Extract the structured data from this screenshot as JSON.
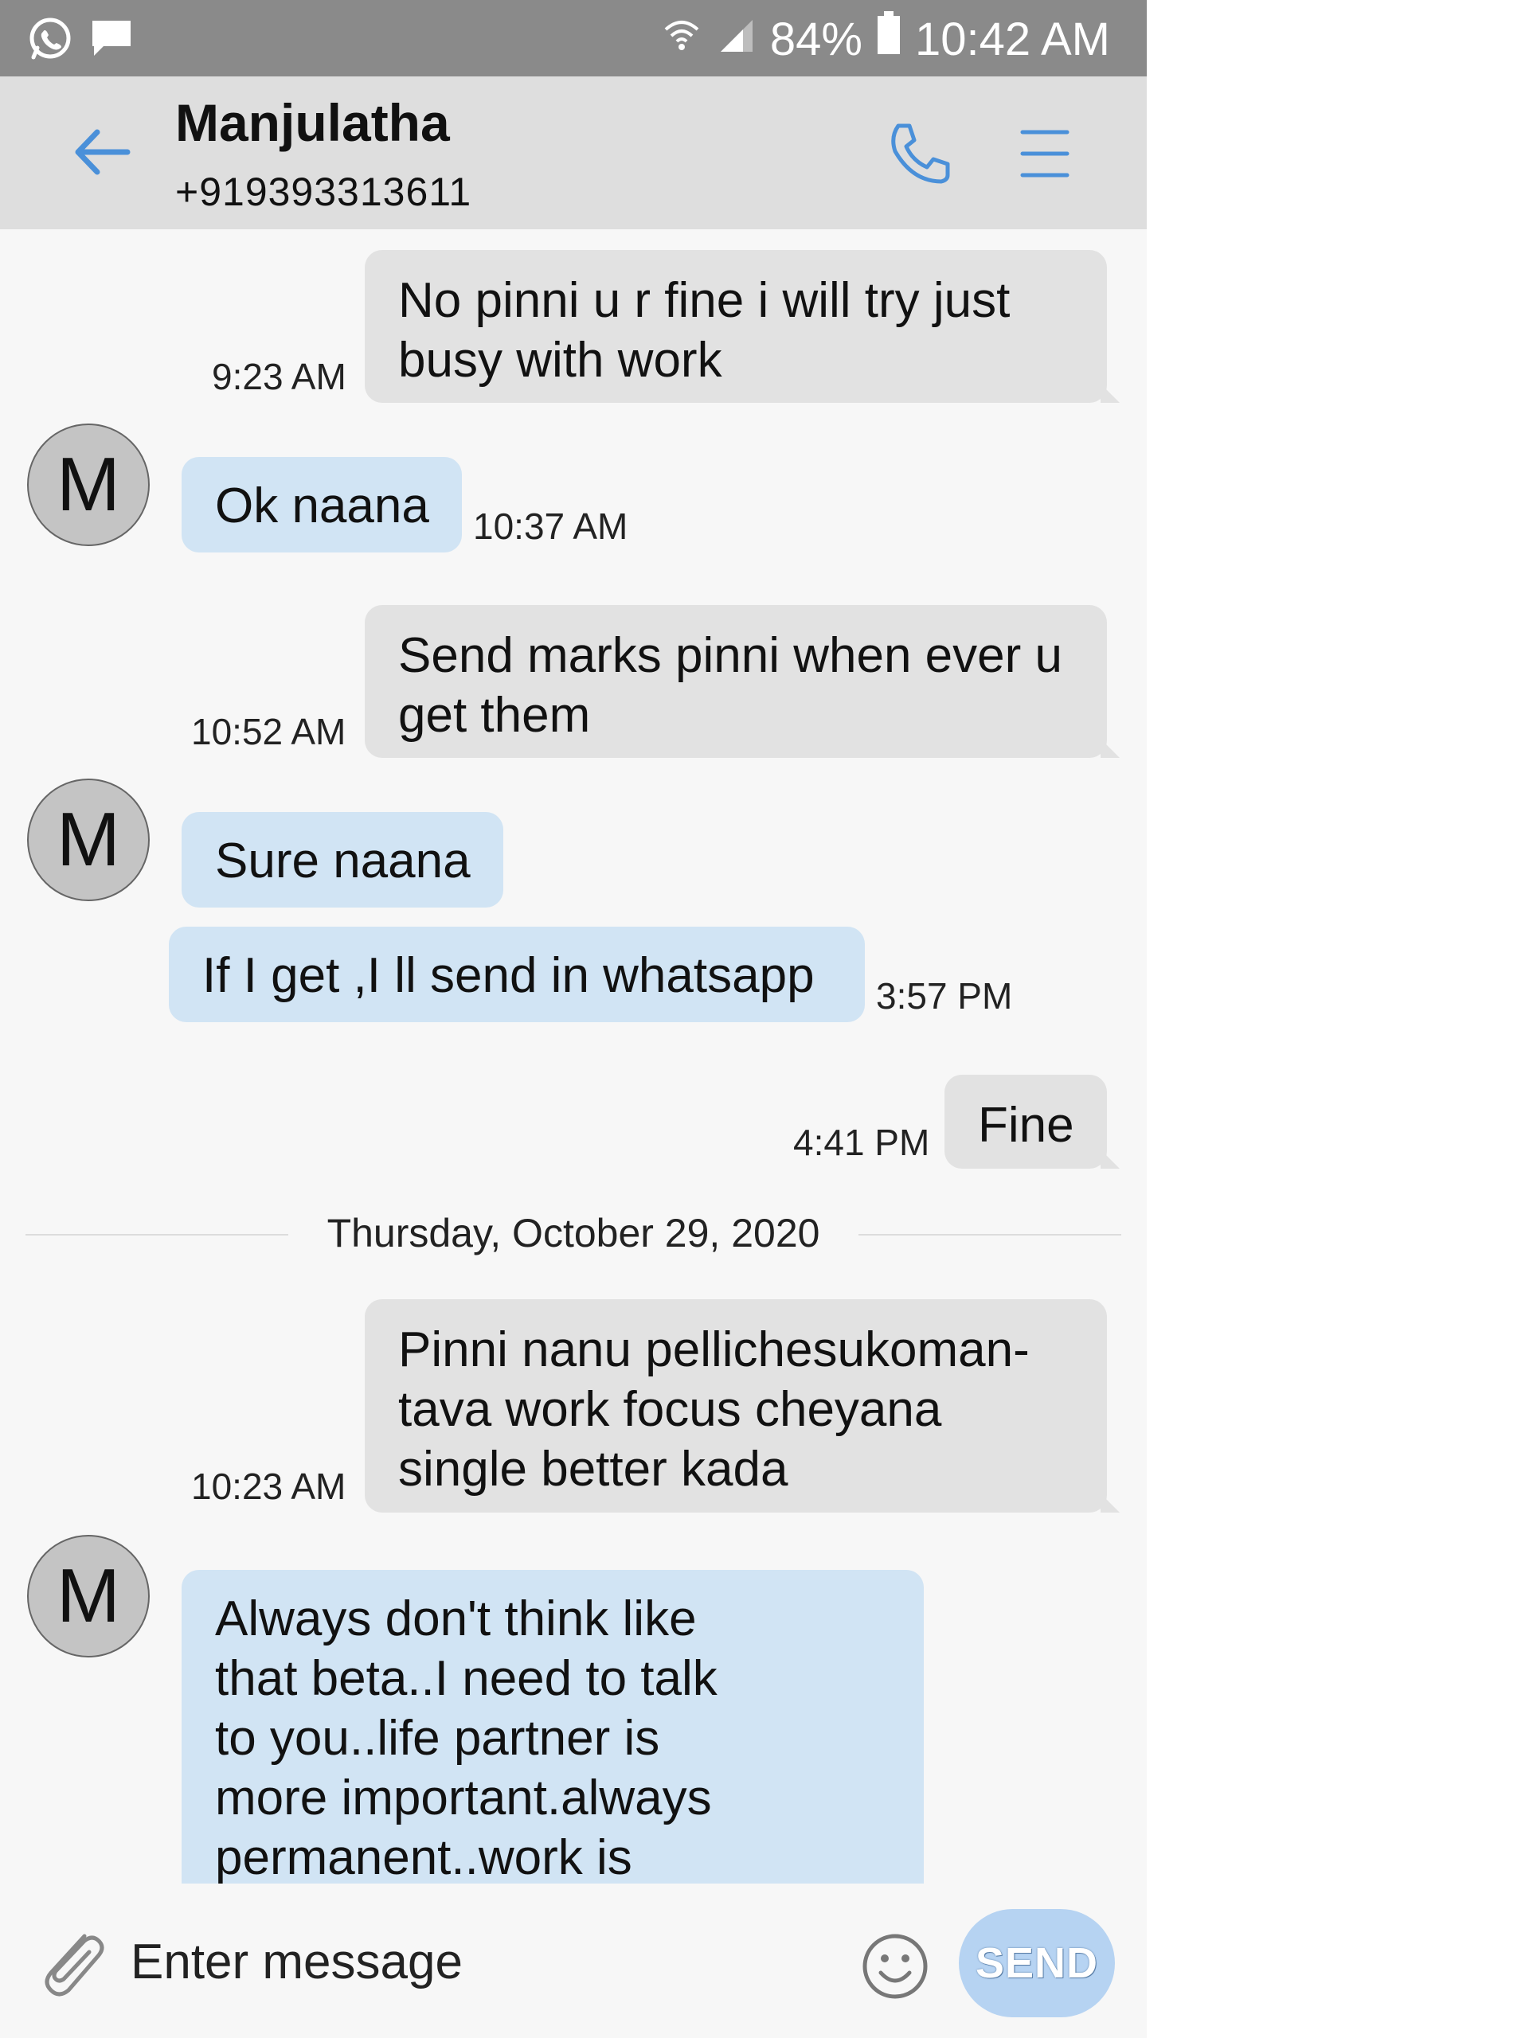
{
  "status_bar": {
    "battery": "84%",
    "time": "10:42 AM",
    "left_icons": [
      "whatsapp-icon",
      "chat-notification-icon"
    ],
    "right_icons": [
      "wifi-icon",
      "signal-icon",
      "battery-icon"
    ]
  },
  "header": {
    "contact_name": "Manjulatha",
    "contact_number": "+919393313611",
    "icons": [
      "back-arrow-icon",
      "phone-icon",
      "menu-icon"
    ]
  },
  "messages": [
    {
      "dir": "out",
      "text": "No pinni u r fine i will try just busy with work",
      "time": "9:23 AM"
    },
    {
      "dir": "in",
      "avatar": "M",
      "text": "Ok naana",
      "time": "10:37 AM"
    },
    {
      "dir": "out",
      "text": "Send marks pinni when ever u get them",
      "time": "10:52 AM"
    },
    {
      "dir": "in",
      "avatar": "M",
      "text": "Sure naana",
      "time": ""
    },
    {
      "dir": "in",
      "text": "If I get ,I ll send in whatsapp",
      "time": "3:57 PM"
    },
    {
      "dir": "out",
      "text": "Fine",
      "time": "4:41 PM"
    },
    {
      "dir": "out",
      "text": "Pinni nanu pellichesukoman-tava work focus cheyana single better kada",
      "time": "10:23 AM"
    },
    {
      "dir": "in",
      "avatar": "M",
      "text": "Always don't think like that beta..I need to talk to you..life partner is more important.always permanent..work is",
      "time": ""
    }
  ],
  "date_separator": "Thursday, October 29, 2020",
  "composer": {
    "placeholder": "Enter message",
    "send_label": "SEND",
    "icons": [
      "paperclip-icon",
      "emoji-icon"
    ]
  },
  "colors": {
    "status_bar": "#8a8a8a",
    "header": "#dedede",
    "outgoing_bubble": "#e2e2e2",
    "incoming_bubble": "#d1e4f4",
    "accent": "#4a90d9",
    "send_button": "#b6d3f2"
  }
}
